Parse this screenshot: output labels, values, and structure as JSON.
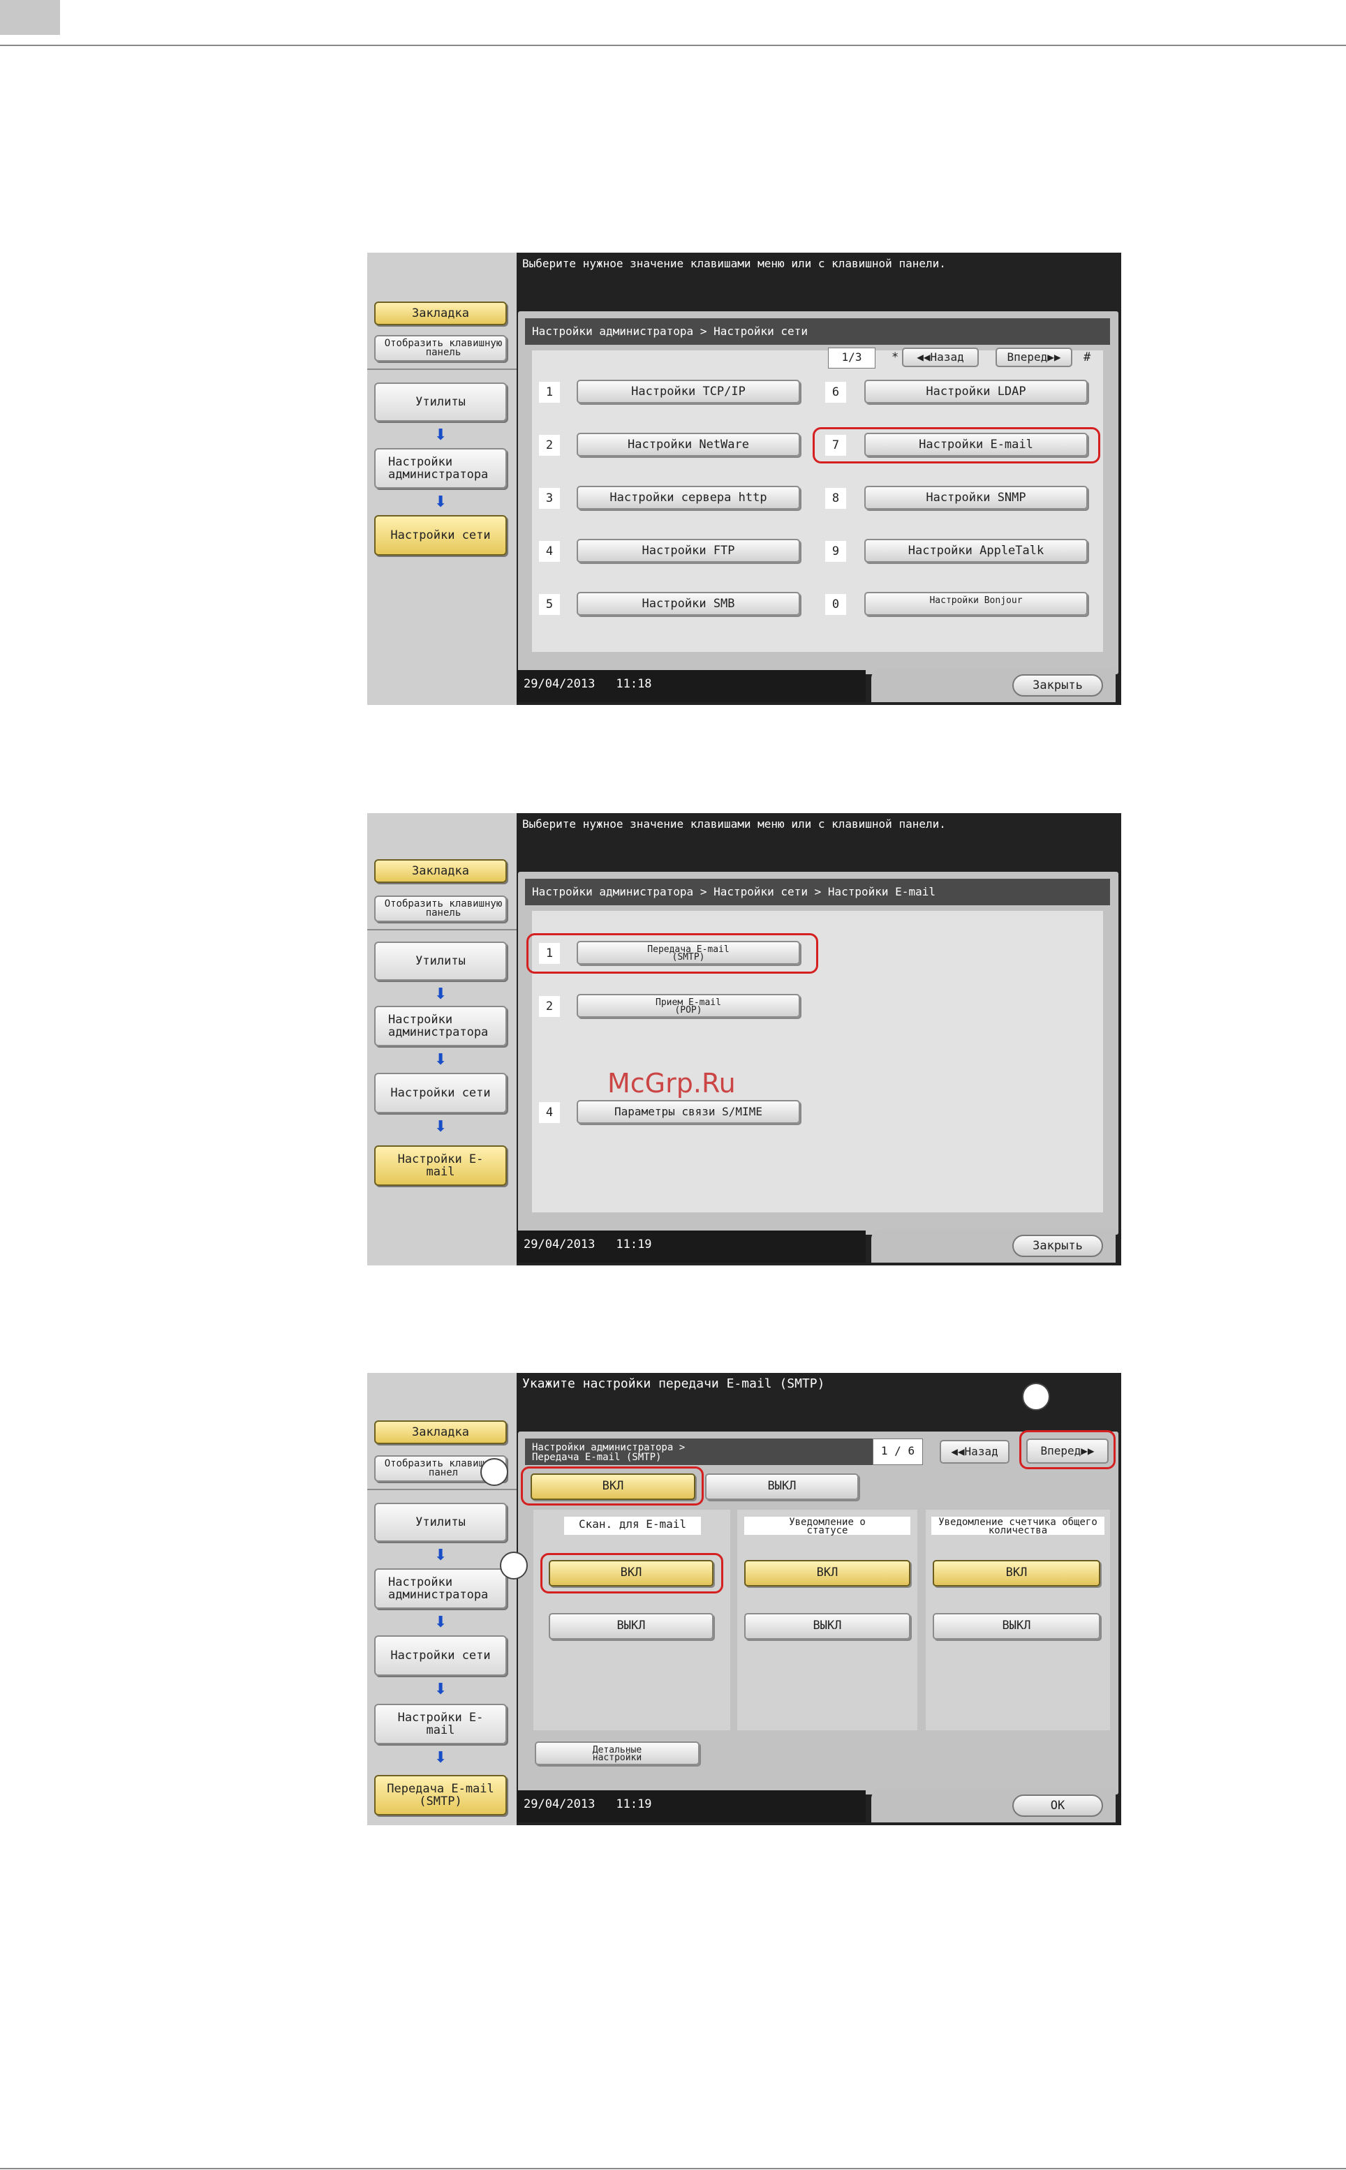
{
  "watermark": "McGrp.Ru",
  "left_panel": {
    "bookmark": "Закладка",
    "show_keypad": "Отобразить клавишную панель",
    "show_keypad_cut": "Отобразить клавишную панел",
    "utilities": "Утилиты",
    "admin_settings": "Настройки администратора",
    "network_settings": "Настройки сети",
    "email_settings": "Настройки E-mail",
    "email_tx_smtp": "Передача E-mail (SMTP)"
  },
  "screen1": {
    "message": "Выберите нужное значение клавишами меню или с клавишной панели.",
    "breadcrumb": "Настройки администратора > Настройки сети",
    "page": "1/3",
    "prev_key": "*",
    "prev": "Назад",
    "next": "Вперед",
    "next_key": "#",
    "items": [
      {
        "num": "1",
        "label": "Настройки TCP/IP"
      },
      {
        "num": "2",
        "label": "Настройки NetWare"
      },
      {
        "num": "3",
        "label": "Настройки сервера http"
      },
      {
        "num": "4",
        "label": "Настройки FTP"
      },
      {
        "num": "5",
        "label": "Настройки SMB"
      },
      {
        "num": "6",
        "label": "Настройки LDAP"
      },
      {
        "num": "7",
        "label": "Настройки E-mail"
      },
      {
        "num": "8",
        "label": "Настройки SNMP"
      },
      {
        "num": "9",
        "label": "Настройки AppleTalk"
      },
      {
        "num": "0",
        "label": "Настройки Bonjour"
      }
    ],
    "date": "29/04/2013",
    "time": "11:18",
    "close": "Закрыть"
  },
  "screen2": {
    "message": "Выберите нужное значение клавишами меню или с клавишной панели.",
    "breadcrumb": "Настройки администратора > Настройки сети > Настройки E-mail",
    "items": [
      {
        "num": "1",
        "label": "Передача E-mail (SMTP)"
      },
      {
        "num": "2",
        "label": "Прием E-mail (POP)"
      },
      {
        "num": "4",
        "label": "Параметры связи S/MIME"
      }
    ],
    "date": "29/04/2013",
    "time": "11:19",
    "close": "Закрыть"
  },
  "screen3": {
    "message": "Укажите настройки передачи  E-mail (SMTP)",
    "breadcrumb_line1": "Настройки администратора >",
    "breadcrumb_line2": "Передача E-mail (SMTP)",
    "page": "1 / 6",
    "prev": "Назад",
    "next": "Вперед",
    "on": "ВКЛ",
    "off": "ВЫКЛ",
    "pane1_title": "Скан. для E-mail",
    "pane2_title": "Уведомление о статусе",
    "pane3_title": "Уведомление счетчика общего количества",
    "details": "Детальные настройки",
    "date": "29/04/2013",
    "time": "11:19",
    "ok": "OK"
  }
}
